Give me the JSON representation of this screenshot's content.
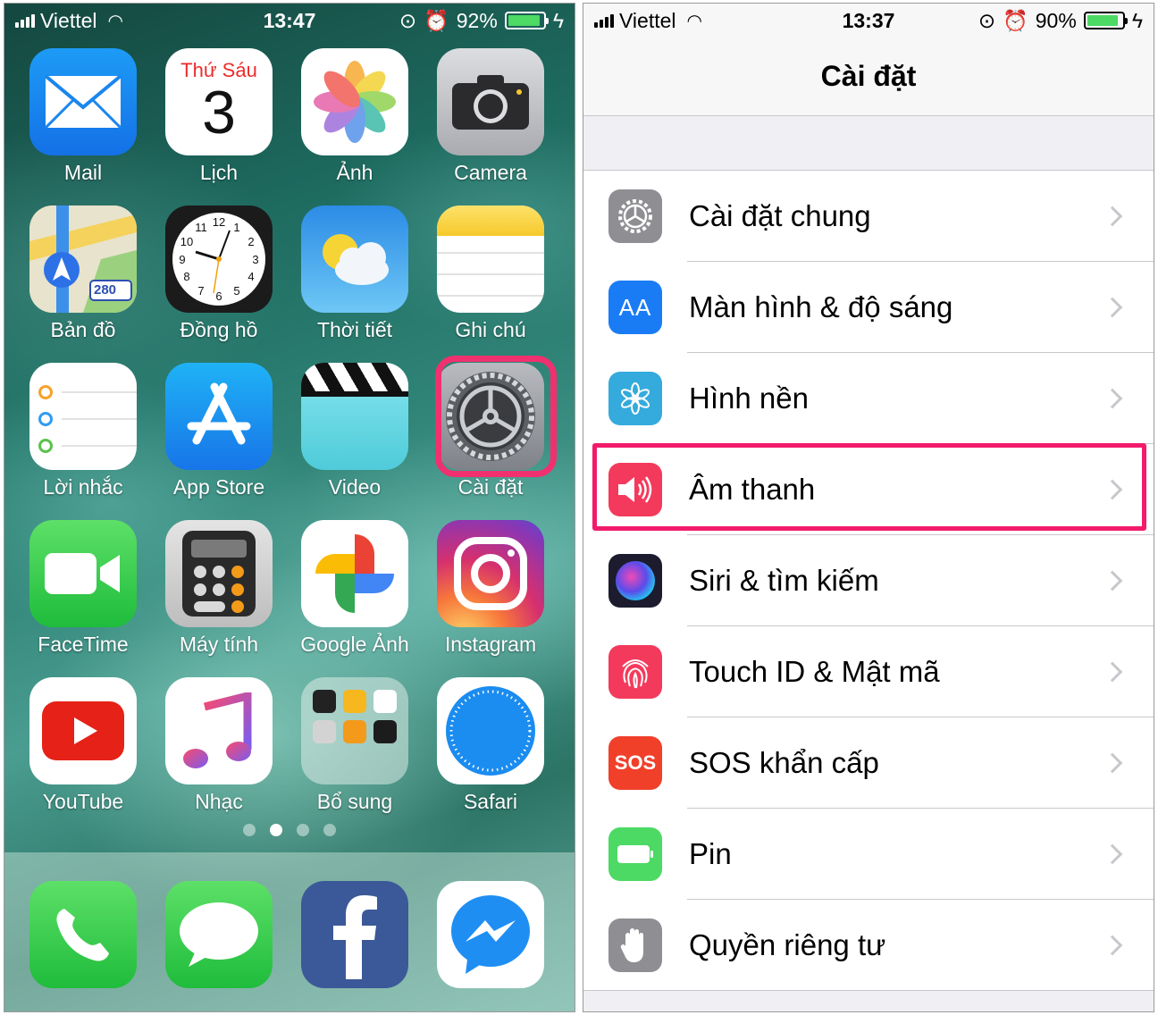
{
  "left_screen": {
    "status": {
      "carrier": "Viettel",
      "time": "13:47",
      "battery": "92%",
      "battery_level": 0.92
    },
    "apps": [
      {
        "name": "Mail",
        "icon": "mail-icon"
      },
      {
        "name": "Lịch",
        "icon": "calendar-icon",
        "day_name": "Thứ Sáu",
        "day_number": "3"
      },
      {
        "name": "Ảnh",
        "icon": "photos-icon"
      },
      {
        "name": "Camera",
        "icon": "camera-icon"
      },
      {
        "name": "Bản đồ",
        "icon": "maps-icon",
        "badge": "280"
      },
      {
        "name": "Đồng hồ",
        "icon": "clock-icon"
      },
      {
        "name": "Thời tiết",
        "icon": "weather-icon"
      },
      {
        "name": "Ghi chú",
        "icon": "notes-icon"
      },
      {
        "name": "Lời nhắc",
        "icon": "reminders-icon"
      },
      {
        "name": "App Store",
        "icon": "app-store-icon"
      },
      {
        "name": "Video",
        "icon": "video-icon"
      },
      {
        "name": "Cài đặt",
        "icon": "settings-icon",
        "highlighted": true
      },
      {
        "name": "FaceTime",
        "icon": "facetime-icon"
      },
      {
        "name": "Máy tính",
        "icon": "calculator-icon"
      },
      {
        "name": "Google Ảnh",
        "icon": "google-photos-icon"
      },
      {
        "name": "Instagram",
        "icon": "instagram-icon"
      },
      {
        "name": "YouTube",
        "icon": "youtube-icon"
      },
      {
        "name": "Nhạc",
        "icon": "music-icon"
      },
      {
        "name": "Bổ sung",
        "icon": "extras-folder-icon"
      },
      {
        "name": "Safari",
        "icon": "safari-icon"
      }
    ],
    "page_dots": {
      "count": 4,
      "active": 1
    },
    "dock": [
      {
        "icon": "phone-icon"
      },
      {
        "icon": "messages-icon"
      },
      {
        "icon": "facebook-icon"
      },
      {
        "icon": "messenger-icon"
      }
    ],
    "highlight_color": "#f1306f"
  },
  "right_screen": {
    "status": {
      "carrier": "Viettel",
      "time": "13:37",
      "battery": "90%",
      "battery_level": 0.9
    },
    "title": "Cài đặt",
    "rows": [
      {
        "label": "Cài đặt chung",
        "icon": "gear-icon",
        "color": "#8e8e93"
      },
      {
        "label": "Màn hình & độ sáng",
        "icon": "display-aa-icon",
        "icon_text": "AA",
        "color": "#1a7cf5"
      },
      {
        "label": "Hình nền",
        "icon": "wallpaper-flower-icon",
        "color": "#35aadc"
      },
      {
        "label": "Âm thanh",
        "icon": "speaker-icon",
        "color": "#f43a5c",
        "highlighted": true
      },
      {
        "label": "Siri & tìm kiếm",
        "icon": "siri-icon",
        "color": "#1c1c2e"
      },
      {
        "label": "Touch ID & Mật mã",
        "icon": "fingerprint-icon",
        "color": "#f43a5c"
      },
      {
        "label": "SOS khẩn cấp",
        "icon": "sos-icon",
        "icon_text": "SOS",
        "color": "#f0402a"
      },
      {
        "label": "Pin",
        "icon": "battery-icon",
        "color": "#4cd964"
      },
      {
        "label": "Quyền riêng tư",
        "icon": "hand-icon",
        "color": "#8e8e93"
      }
    ],
    "highlight_color": "#f21b6b"
  }
}
